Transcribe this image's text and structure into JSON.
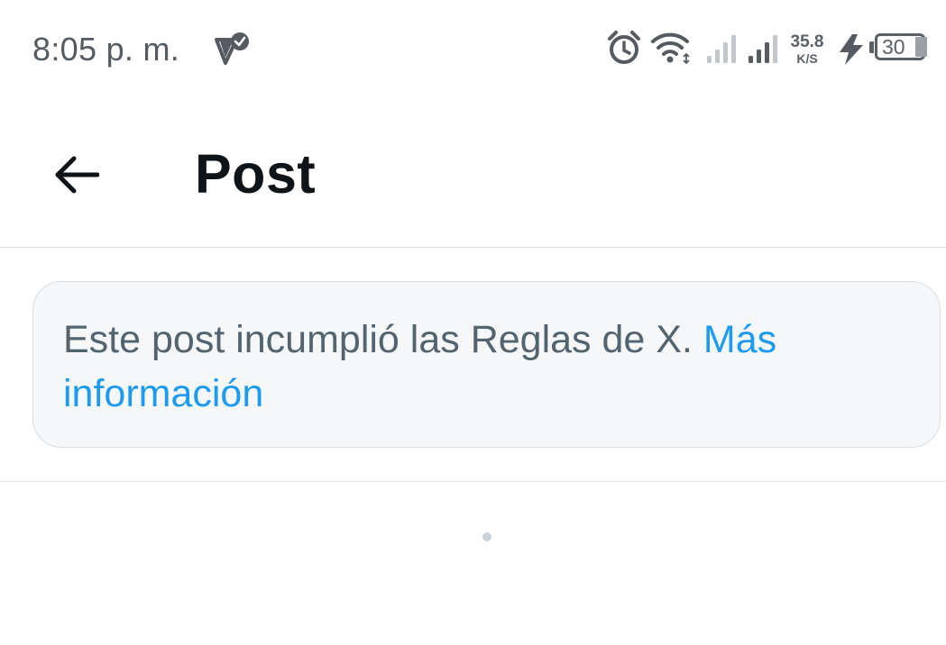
{
  "status_bar": {
    "time": "8:05 p. m.",
    "net_speed_value": "35.8",
    "net_speed_unit": "K/S",
    "battery_level": "30",
    "icons": [
      "notification-check-icon",
      "alarm-icon",
      "wifi-icon",
      "signal-icon",
      "signal-icon",
      "charging-bolt-icon",
      "battery-icon"
    ]
  },
  "header": {
    "back_icon": "arrow-left-icon",
    "title": "Post"
  },
  "notice": {
    "text": "Este post incumplió las Reglas de X.",
    "link_label": "Más información"
  },
  "colors": {
    "text_primary": "#0f1419",
    "text_secondary": "#536471",
    "link": "#1d9bf0",
    "card_background": "#f5f7f8",
    "divider": "#dfe3e6"
  }
}
